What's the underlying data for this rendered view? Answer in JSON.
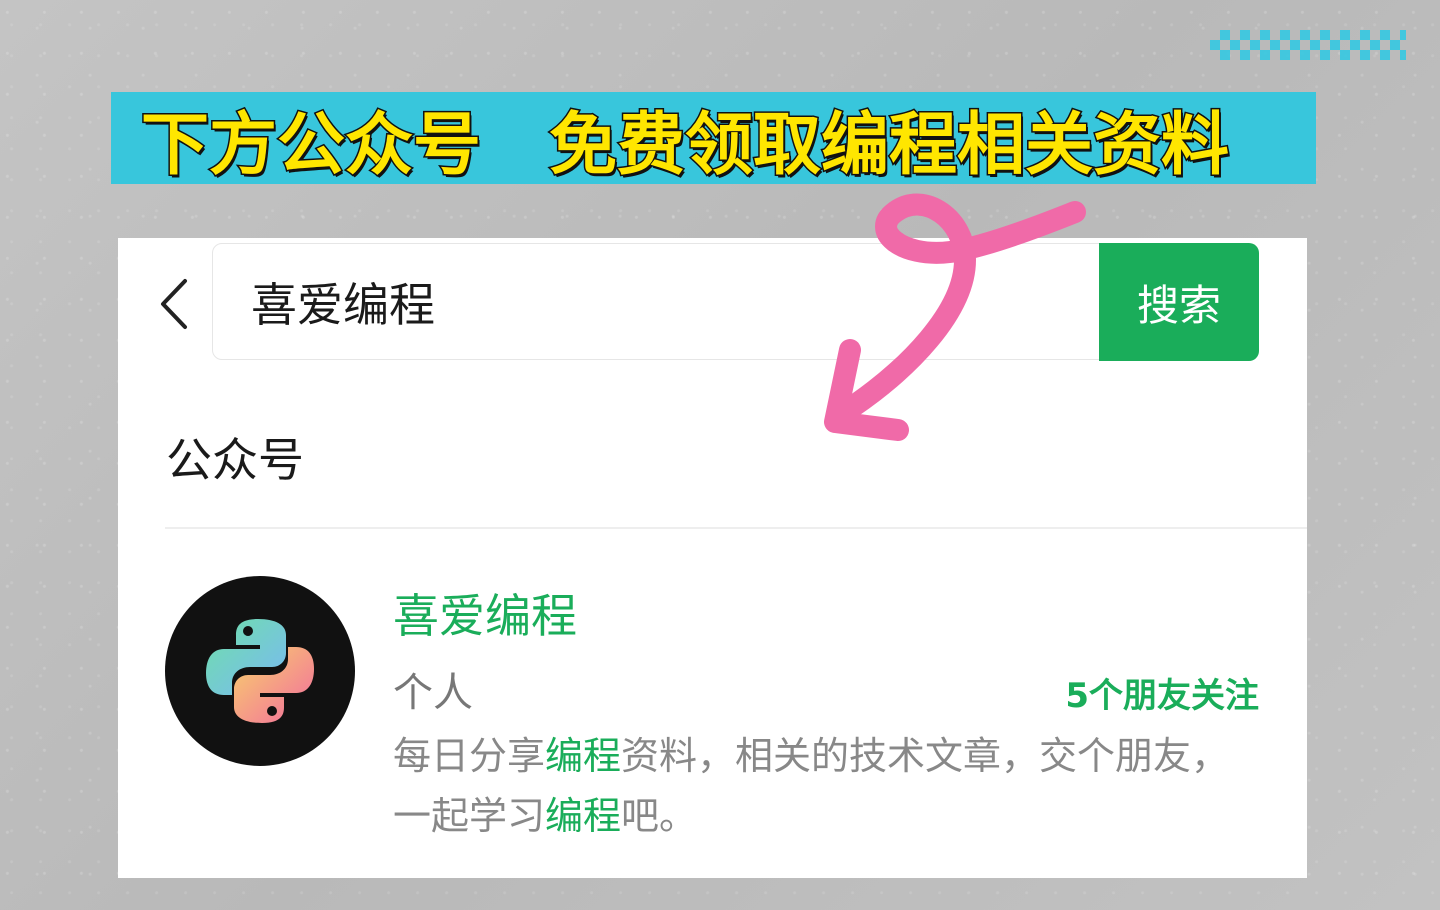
{
  "banner": {
    "text": "下方公众号　免费领取编程相关资料"
  },
  "search": {
    "value": "喜爱编程",
    "button_label": "搜索"
  },
  "section": {
    "title": "公众号"
  },
  "result": {
    "name": "喜爱编程",
    "type": "个人",
    "friends": "5个朋友关注",
    "desc": {
      "p1": "每日分享",
      "h1": "编程",
      "p2": "资料，相关的技术文章，交个朋友，一起学习",
      "h2": "编程",
      "p3": "吧。"
    }
  },
  "icons": {
    "back": "chevron-left-icon",
    "clear": "clear-circle-icon",
    "avatar": "python-logo-icon",
    "arrow": "hand-drawn-arrow"
  },
  "colors": {
    "accent_green": "#1aad5a",
    "banner_bg": "#38c6dc",
    "banner_text": "#ffe600",
    "arrow": "#f06aa8"
  }
}
